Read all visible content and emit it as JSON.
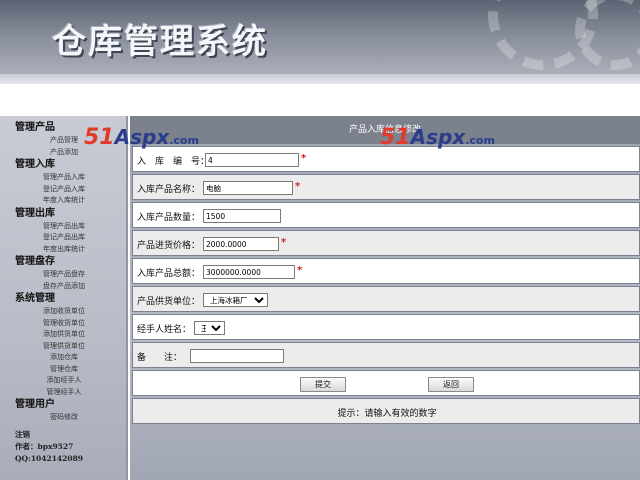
{
  "banner": {
    "title": "仓库管理系统"
  },
  "sidebar": {
    "groups": [
      {
        "title": "管理产品",
        "items": [
          "产品管理",
          "产品添加"
        ]
      },
      {
        "title": "管理入库",
        "items": [
          "管理产品入库",
          "登记产品入库",
          "年度入库统计"
        ]
      },
      {
        "title": "管理出库",
        "items": [
          "管理产品出库",
          "登记产品出库",
          "年度出库统计"
        ]
      },
      {
        "title": "管理盘存",
        "items": [
          "管理产品盘存",
          "盘存产品添加"
        ]
      },
      {
        "title": "系统管理",
        "items": [
          "添加收货单位",
          "管理收货单位",
          "添加供货单位",
          "管理供货单位",
          "添加仓库",
          "管理仓库",
          "添加经手人",
          "管理经手人"
        ]
      },
      {
        "title": "管理用户",
        "items": [
          "密码修改"
        ]
      }
    ],
    "footer": [
      "注销",
      "作者：bpx9527",
      "QQ:1042142089"
    ]
  },
  "watermark": {
    "num": "51",
    "aspx": "Aspx",
    "com": ".com"
  },
  "form": {
    "header": "产品入库信息修改",
    "fields": {
      "entry_no": {
        "label": "入　库　编　号：",
        "value": "4"
      },
      "product_name": {
        "label": "入库产品名称：",
        "value": "电脑"
      },
      "quantity": {
        "label": "入库产品数量：",
        "value": "1500"
      },
      "price": {
        "label": "产品进货价格：",
        "value": "2000.0000"
      },
      "total": {
        "label": "入库产品总额：",
        "value": "3000000.0000"
      },
      "supplier": {
        "label": "产品供货单位：",
        "value": "上海冰箱厂"
      },
      "handler": {
        "label": "经手人姓名：",
        "value": "王萍"
      },
      "remark": {
        "label": "备　　注：",
        "value": ""
      }
    },
    "required_mark": "*",
    "buttons": {
      "submit": "提交",
      "back": "返回"
    },
    "hint": "提示：请输入有效的数字"
  }
}
